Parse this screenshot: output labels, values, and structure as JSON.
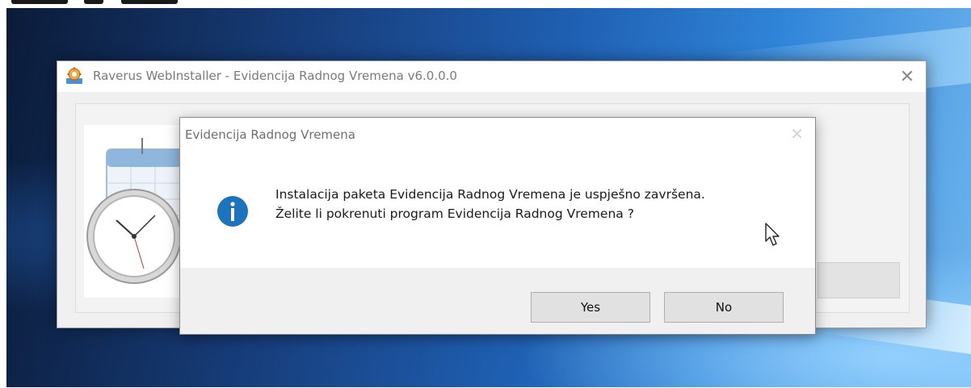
{
  "installer": {
    "title": "Raverus WebInstaller - Evidencija Radnog Vremena v6.0.0.0",
    "close_glyph": "✕",
    "icon": "gear-installer-icon",
    "image": "calendar-clock-illustration"
  },
  "dialog": {
    "caption": "Evidencija Radnog Vremena",
    "close_glyph": "✕",
    "icon": "info-icon",
    "message_line1": "Instalacija paketa Evidencija Radnog Vremena je uspješno završena.",
    "message_line2": "Želite li pokrenuti program Evidencija Radnog Vremena ?",
    "yes_label": "Yes",
    "no_label": "No"
  },
  "colors": {
    "info_icon": "#1e73be",
    "desktop_accent": "#1f5fb2"
  }
}
